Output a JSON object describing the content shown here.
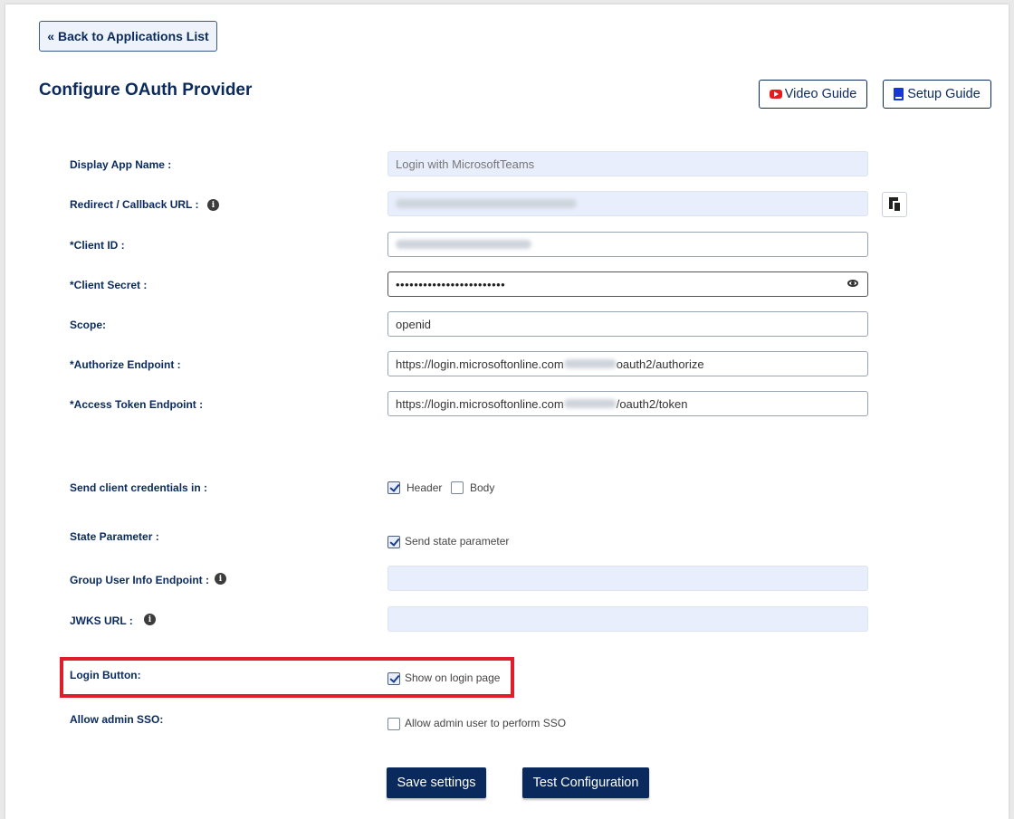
{
  "back_button": "« Back to Applications List",
  "title": "Configure OAuth Provider",
  "video_guide": "Video Guide",
  "setup_guide": "Setup Guide",
  "fields": {
    "display_app_name": {
      "label": "Display App Name :",
      "value": "Login with MicrosoftTeams"
    },
    "redirect_url": {
      "label": "Redirect / Callback URL :"
    },
    "client_id": {
      "label": "*Client ID :"
    },
    "client_secret": {
      "label": "*Client Secret :",
      "value": "••••••••••••••••••••••••"
    },
    "scope": {
      "label": "Scope:",
      "value": "openid"
    },
    "authorize_endpoint": {
      "label": "*Authorize Endpoint :",
      "prefix": "https://login.microsoftonline.com",
      "suffix": "oauth2/authorize"
    },
    "access_token_endpoint": {
      "label": "*Access Token Endpoint :",
      "prefix": "https://login.microsoftonline.com",
      "suffix": "/oauth2/token"
    },
    "send_credentials": {
      "label": "Send client credentials in :",
      "header": "Header",
      "body": "Body"
    },
    "state_parameter": {
      "label": "State Parameter :",
      "option": "Send state parameter"
    },
    "group_user_info": {
      "label": "Group User Info Endpoint :"
    },
    "jwks_url": {
      "label": "JWKS URL :"
    },
    "login_button": {
      "label": "Login Button:",
      "option": "Show on login page"
    },
    "admin_sso": {
      "label": "Allow admin SSO:",
      "option": "Allow admin user to perform SSO"
    }
  },
  "actions": {
    "save": "Save settings",
    "test": "Test Configuration"
  },
  "colors": {
    "primary": "#0a2a5e",
    "highlight": "#e01d2b",
    "readonly_bg": "#e8eefc"
  }
}
